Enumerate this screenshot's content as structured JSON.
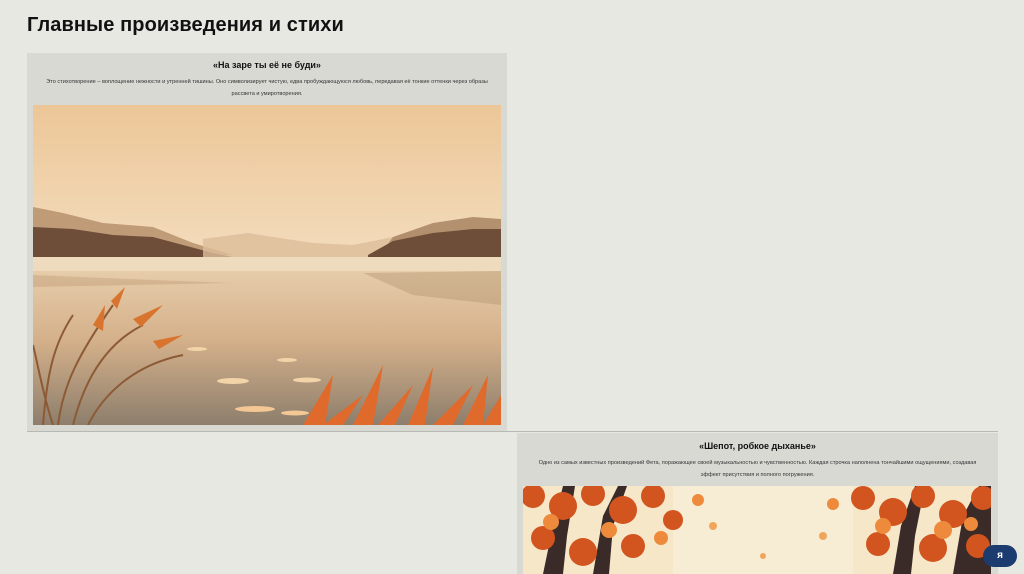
{
  "page": {
    "title": "Главные произведения и стихи"
  },
  "cards": [
    {
      "title": "«На заре ты её не буди»",
      "description": "Это стихотворение – воплощение нежности и утренней тишины. Оно символизирует чистую, едва пробуждающуюся любовь, передавая её тонкие оттенки через образы рассвета и умиротворения."
    },
    {
      "title": "«Шепот, робкое дыханье»",
      "description": "Одно из самых известных произведений Фета, поражающее своей музыкальностью и чувственностью. Каждая строчка наполнена тончайшими ощущениями, создавая эффект присутствия и полного погружения."
    }
  ],
  "corner_badge": {
    "label": "я"
  },
  "colors": {
    "background": "#e8e8e3",
    "card": "#d9d9d4",
    "badge": "#1c3b6e"
  }
}
